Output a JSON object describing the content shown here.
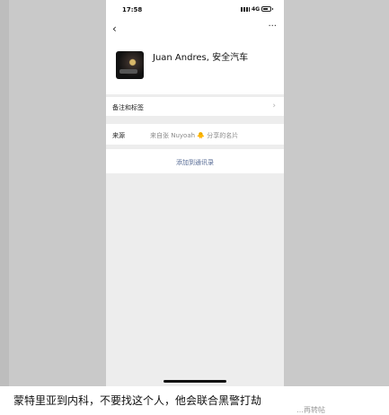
{
  "status_bar": {
    "time": "17:58",
    "network": "4G"
  },
  "nav": {
    "back_icon": "chevron-left-icon",
    "more_label": "···"
  },
  "profile": {
    "name": "Juan Andres, 安全汽车"
  },
  "rows": {
    "notes_label": "备注和标签",
    "source_label": "来源",
    "source_value": "来自张 Nuyoah 🐥 分享的名片",
    "add_contact_label": "添加到通讯录"
  },
  "caption": {
    "text": "蒙特里亚到内科，不要找这个人，他会联合黑警打劫",
    "tail": "…再转帖"
  }
}
